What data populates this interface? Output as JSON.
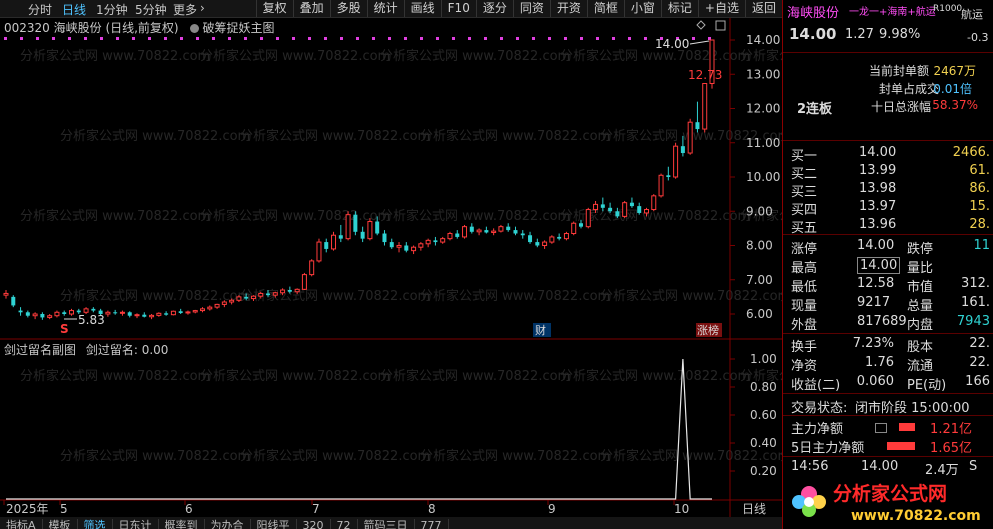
{
  "top_bar": {
    "periods": [
      "分时",
      "日线",
      "1分钟",
      "5分钟",
      "更多"
    ],
    "active_period": "日线",
    "tools": [
      "复权",
      "叠加",
      "多股",
      "统计",
      "画线",
      "F10",
      "逐分",
      "同资",
      "开资",
      "简框",
      "小窗",
      "标记",
      "+自选",
      "返回"
    ]
  },
  "main_chart": {
    "title_code_name": "002320 海峡股份 (日线,前复权)",
    "indicator": "破筹捉妖主图",
    "max_label": "14.00",
    "last_label": "12.73",
    "min_label": "5.83",
    "markers": {
      "s": "S",
      "cai": "财",
      "zhangbang": "涨榜"
    }
  },
  "sub_chart": {
    "title": "剑过留名副图",
    "value_label": "剑过留名: 0.00"
  },
  "x_axis": {
    "labels": [
      "2025年",
      "5",
      "6",
      "7",
      "8",
      "9",
      "10"
    ],
    "corner": "日线"
  },
  "bottom_tabs": [
    "指标A",
    "模板",
    "筛选",
    "日东计",
    "概率到",
    "为办合",
    "阳线平",
    "320",
    "72",
    "箭码三日",
    "777"
  ],
  "quote": {
    "name": "海峡股份",
    "ticker_links": "一龙一+海南+航运",
    "rlevel": "R1000",
    "price": "14.00",
    "change": "1.27",
    "change_pct": "9.98%",
    "peer_name": "航运",
    "peer_change": "-0.3",
    "limit_info": [
      {
        "label": "当前封单额",
        "value": "2467万"
      },
      {
        "label": "封单占成交",
        "value": "0.01倍"
      },
      {
        "label": "十日总涨幅",
        "value": "58.37%"
      }
    ],
    "streak": "2连板",
    "bids": [
      {
        "label": "买一",
        "price": "14.00",
        "vol": "2466."
      },
      {
        "label": "买二",
        "price": "13.99",
        "vol": "61."
      },
      {
        "label": "买三",
        "price": "13.98",
        "vol": "86."
      },
      {
        "label": "买四",
        "price": "13.97",
        "vol": "15."
      },
      {
        "label": "买五",
        "price": "13.96",
        "vol": "28."
      }
    ],
    "stats_left": [
      {
        "label": "涨停",
        "value": "14.00"
      },
      {
        "label": "最高",
        "value": "14.00"
      },
      {
        "label": "最低",
        "value": "12.58"
      },
      {
        "label": "现量",
        "value": "9217"
      },
      {
        "label": "外盘",
        "value": "817689"
      }
    ],
    "stats_right": [
      {
        "label": "跌停",
        "value": "11"
      },
      {
        "label": "量比",
        "value": ""
      },
      {
        "label": "市值",
        "value": "312."
      },
      {
        "label": "总量",
        "value": "161."
      },
      {
        "label": "内盘",
        "value": "7943"
      }
    ],
    "fund_left": [
      {
        "label": "换手",
        "value": "7.23%"
      },
      {
        "label": "净资",
        "value": "1.76"
      },
      {
        "label": "收益(二)",
        "value": "0.060"
      }
    ],
    "fund_right": [
      {
        "label": "股本",
        "value": "22."
      },
      {
        "label": "流通",
        "value": "22."
      },
      {
        "label": "PE(动)",
        "value": "166"
      }
    ],
    "trade_status_label": "交易状态:",
    "trade_status": "闭市阶段 15:00:00",
    "main_net": {
      "label": "主力净额",
      "value": "1.21亿"
    },
    "main_net_5d": {
      "label": "5日主力净额",
      "value": "1.65亿"
    },
    "tick": {
      "time": "14:56",
      "price": "14.00",
      "vol": "2.4万",
      "flag": "S"
    }
  },
  "watermark": "分析家公式网 www.70822.com",
  "logo": {
    "text": "分析家公式网",
    "url": "www.70822.com"
  },
  "chart_data": {
    "type": "candlestick",
    "ylim": [
      5.5,
      14.5
    ],
    "yticks": [
      6.0,
      7.0,
      8.0,
      9.0,
      10.0,
      11.0,
      12.0,
      13.0,
      14.0
    ],
    "sub_yticks": [
      0.2,
      0.4,
      0.6,
      0.8,
      1.0
    ],
    "candles": [
      [
        6.55,
        6.7,
        6.45,
        6.6
      ],
      [
        6.5,
        6.55,
        6.2,
        6.25
      ],
      [
        6.1,
        6.2,
        5.95,
        6.05
      ],
      [
        6.05,
        6.1,
        5.9,
        5.95
      ],
      [
        5.95,
        6.05,
        5.85,
        6.0
      ],
      [
        6.0,
        6.05,
        5.83,
        5.9
      ],
      [
        5.9,
        6.0,
        5.85,
        5.95
      ],
      [
        5.95,
        6.1,
        5.9,
        6.05
      ],
      [
        6.05,
        6.1,
        5.95,
        6.0
      ],
      [
        6.0,
        6.15,
        5.95,
        6.1
      ],
      [
        6.1,
        6.15,
        6.0,
        6.05
      ],
      [
        6.05,
        6.2,
        6.0,
        6.15
      ],
      [
        6.15,
        6.2,
        6.05,
        6.1
      ],
      [
        6.1,
        6.15,
        5.95,
        6.0
      ],
      [
        6.0,
        6.1,
        5.92,
        6.05
      ],
      [
        6.05,
        6.12,
        5.98,
        6.02
      ],
      [
        6.02,
        6.1,
        5.95,
        6.05
      ],
      [
        6.05,
        6.08,
        5.9,
        5.95
      ],
      [
        5.95,
        6.02,
        5.88,
        5.98
      ],
      [
        5.98,
        6.05,
        5.9,
        5.92
      ],
      [
        5.92,
        6.0,
        5.85,
        5.96
      ],
      [
        5.96,
        6.05,
        5.92,
        6.02
      ],
      [
        6.02,
        6.08,
        5.95,
        5.98
      ],
      [
        5.98,
        6.1,
        5.96,
        6.08
      ],
      [
        6.08,
        6.15,
        6.0,
        6.03
      ],
      [
        6.03,
        6.1,
        5.98,
        6.06
      ],
      [
        6.06,
        6.12,
        6.02,
        6.1
      ],
      [
        6.1,
        6.2,
        6.05,
        6.15
      ],
      [
        6.15,
        6.25,
        6.1,
        6.2
      ],
      [
        6.2,
        6.3,
        6.15,
        6.28
      ],
      [
        6.28,
        6.4,
        6.2,
        6.35
      ],
      [
        6.35,
        6.45,
        6.28,
        6.4
      ],
      [
        6.4,
        6.55,
        6.35,
        6.5
      ],
      [
        6.5,
        6.6,
        6.4,
        6.45
      ],
      [
        6.45,
        6.55,
        6.38,
        6.52
      ],
      [
        6.52,
        6.65,
        6.45,
        6.6
      ],
      [
        6.6,
        6.7,
        6.5,
        6.55
      ],
      [
        6.55,
        6.65,
        6.48,
        6.62
      ],
      [
        6.62,
        6.75,
        6.55,
        6.7
      ],
      [
        6.7,
        6.8,
        6.6,
        6.65
      ],
      [
        6.65,
        6.75,
        6.58,
        6.72
      ],
      [
        6.72,
        7.2,
        6.7,
        7.15
      ],
      [
        7.15,
        7.6,
        7.1,
        7.55
      ],
      [
        7.55,
        8.2,
        7.5,
        8.1
      ],
      [
        8.1,
        8.2,
        7.8,
        7.9
      ],
      [
        7.9,
        8.4,
        7.85,
        8.3
      ],
      [
        8.3,
        8.6,
        8.1,
        8.2
      ],
      [
        8.2,
        9.0,
        8.15,
        8.9
      ],
      [
        8.9,
        9.0,
        8.3,
        8.4
      ],
      [
        8.4,
        8.55,
        8.1,
        8.2
      ],
      [
        8.2,
        8.8,
        8.15,
        8.7
      ],
      [
        8.7,
        8.85,
        8.3,
        8.35
      ],
      [
        8.35,
        8.45,
        8.0,
        8.1
      ],
      [
        8.1,
        8.2,
        7.9,
        7.95
      ],
      [
        7.95,
        8.1,
        7.8,
        8.0
      ],
      [
        8.0,
        8.1,
        7.8,
        7.85
      ],
      [
        7.85,
        8.0,
        7.75,
        7.95
      ],
      [
        7.95,
        8.1,
        7.85,
        8.05
      ],
      [
        8.05,
        8.2,
        7.95,
        8.15
      ],
      [
        8.15,
        8.25,
        8.0,
        8.1
      ],
      [
        8.1,
        8.25,
        8.05,
        8.2
      ],
      [
        8.2,
        8.4,
        8.15,
        8.35
      ],
      [
        8.35,
        8.45,
        8.2,
        8.25
      ],
      [
        8.25,
        8.6,
        8.2,
        8.55
      ],
      [
        8.55,
        8.65,
        8.35,
        8.4
      ],
      [
        8.4,
        8.5,
        8.3,
        8.45
      ],
      [
        8.45,
        8.55,
        8.35,
        8.38
      ],
      [
        8.38,
        8.5,
        8.3,
        8.42
      ],
      [
        8.42,
        8.6,
        8.38,
        8.55
      ],
      [
        8.55,
        8.65,
        8.4,
        8.45
      ],
      [
        8.45,
        8.55,
        8.3,
        8.35
      ],
      [
        8.35,
        8.45,
        8.2,
        8.3
      ],
      [
        8.3,
        8.4,
        8.05,
        8.1
      ],
      [
        8.1,
        8.2,
        7.95,
        8.0
      ],
      [
        8.0,
        8.15,
        7.9,
        8.1
      ],
      [
        8.1,
        8.3,
        8.05,
        8.25
      ],
      [
        8.25,
        8.35,
        8.15,
        8.2
      ],
      [
        8.2,
        8.4,
        8.15,
        8.35
      ],
      [
        8.35,
        8.7,
        8.3,
        8.65
      ],
      [
        8.65,
        8.75,
        8.5,
        8.55
      ],
      [
        8.55,
        9.1,
        8.5,
        9.05
      ],
      [
        9.05,
        9.3,
        8.95,
        9.2
      ],
      [
        9.2,
        9.4,
        9.0,
        9.1
      ],
      [
        9.1,
        9.25,
        8.95,
        9.0
      ],
      [
        9.0,
        9.1,
        8.8,
        8.85
      ],
      [
        8.85,
        9.3,
        8.8,
        9.25
      ],
      [
        9.25,
        9.4,
        9.1,
        9.15
      ],
      [
        9.15,
        9.25,
        8.9,
        8.95
      ],
      [
        8.95,
        9.1,
        8.85,
        9.05
      ],
      [
        9.05,
        9.5,
        9.0,
        9.45
      ],
      [
        9.45,
        10.1,
        9.4,
        10.05
      ],
      [
        10.05,
        10.3,
        9.9,
        10.0
      ],
      [
        10.0,
        11.0,
        9.95,
        10.9
      ],
      [
        10.9,
        11.2,
        10.6,
        10.7
      ],
      [
        10.7,
        11.7,
        10.65,
        11.6
      ],
      [
        11.6,
        12.2,
        11.3,
        11.4
      ],
      [
        11.4,
        12.73,
        11.3,
        12.73
      ],
      [
        12.73,
        14.0,
        12.58,
        14.0
      ]
    ],
    "sub_series": [
      0,
      0,
      0,
      0,
      0,
      0,
      0,
      0,
      0,
      0,
      0,
      0,
      0,
      0,
      0,
      0,
      0,
      0,
      0,
      0,
      0,
      0,
      0,
      0,
      0,
      0,
      0,
      0,
      0,
      0,
      0,
      0,
      0,
      0,
      0,
      0,
      0,
      0,
      0,
      0,
      0,
      0,
      0,
      0,
      0,
      0,
      0,
      0,
      0,
      0,
      0,
      0,
      0,
      0,
      0,
      0,
      0,
      0,
      0,
      0,
      0,
      0,
      0,
      0,
      0,
      0,
      0,
      0,
      0,
      0,
      0,
      0,
      0,
      0,
      0,
      0,
      0,
      0,
      0,
      0,
      0,
      0,
      0,
      0,
      0,
      0,
      0,
      0,
      0,
      0,
      0,
      0,
      0,
      1,
      0,
      0,
      0,
      0
    ]
  }
}
